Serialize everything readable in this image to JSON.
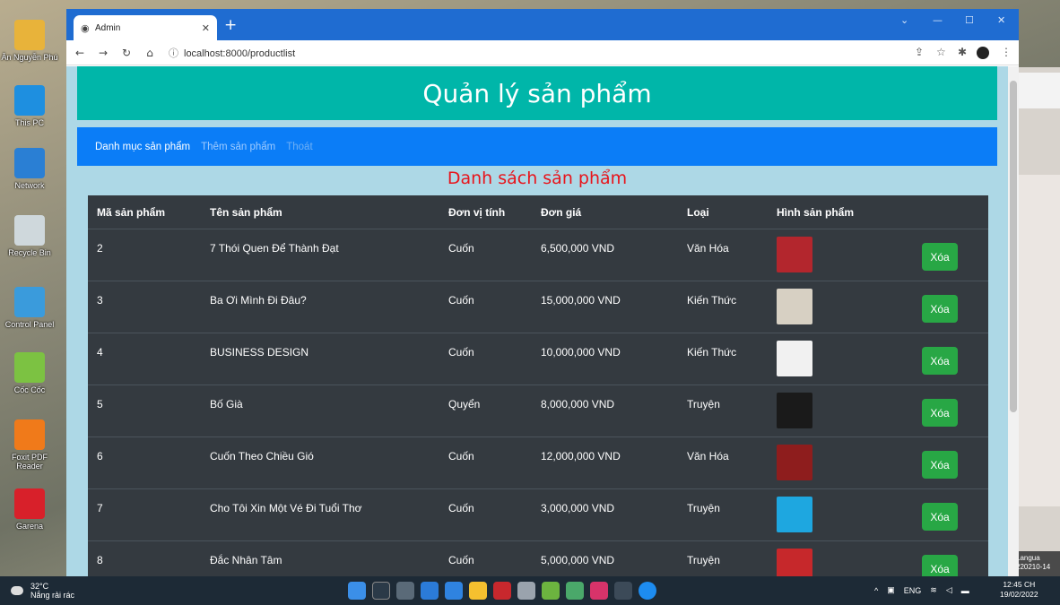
{
  "desktop": {
    "icons": [
      {
        "label": "Ân Nguyễn Phú",
        "color": "#e8b33a"
      },
      {
        "label": "This PC",
        "color": "#1e8fe0"
      },
      {
        "label": "Network",
        "color": "#2a7fd4"
      },
      {
        "label": "Recycle Bin",
        "color": "#cfd8dc"
      },
      {
        "label": "Control Panel",
        "color": "#3a9bdc"
      },
      {
        "label": "Cốc Cốc",
        "color": "#7cc242"
      },
      {
        "label": "Foxit PDF Reader",
        "color": "#f07a1a"
      },
      {
        "label": "Garena",
        "color": "#d8202a"
      }
    ],
    "side_text": "Langua",
    "side_text2": "220210-14"
  },
  "browser": {
    "tab_title": "Admin",
    "url": "localhost:8000/productlist"
  },
  "page": {
    "header_title": "Quản lý sản phẩm",
    "nav": {
      "item1": "Danh mục sản phẩm",
      "item2": "Thêm sản phẩm",
      "item3": "Thoát"
    },
    "list_title": "Danh sách sản phẩm",
    "columns": {
      "id": "Mã sản phẩm",
      "name": "Tên sản phẩm",
      "unit": "Đơn vị tính",
      "price": "Đơn giá",
      "type": "Loại",
      "image": "Hình sản phẩm"
    },
    "delete_label": "Xóa",
    "rows": [
      {
        "id": "2",
        "name": "7 Thói Quen Để Thành Đạt",
        "unit": "Cuốn",
        "price": "6,500,000 VND",
        "type": "Văn Hóa",
        "thumb_color": "#b3262d"
      },
      {
        "id": "3",
        "name": "Ba Ơi Mình Đi Đâu?",
        "unit": "Cuốn",
        "price": "15,000,000 VND",
        "type": "Kiến Thức",
        "thumb_color": "#d7d0c3"
      },
      {
        "id": "4",
        "name": "BUSINESS DESIGN",
        "unit": "Cuốn",
        "price": "10,000,000 VND",
        "type": "Kiến Thức",
        "thumb_color": "#f1f1f1"
      },
      {
        "id": "5",
        "name": "Bố Già",
        "unit": "Quyển",
        "price": "8,000,000 VND",
        "type": "Truyện",
        "thumb_color": "#1a1a1a"
      },
      {
        "id": "6",
        "name": "Cuốn Theo Chiều Gió",
        "unit": "Cuốn",
        "price": "12,000,000 VND",
        "type": "Văn Hóa",
        "thumb_color": "#8e1d1d"
      },
      {
        "id": "7",
        "name": "Cho Tôi Xin Một Vé Đi Tuổi Thơ",
        "unit": "Cuốn",
        "price": "3,000,000 VND",
        "type": "Truyện",
        "thumb_color": "#1ea7e0"
      },
      {
        "id": "8",
        "name": "Đắc Nhân Tâm",
        "unit": "Cuốn",
        "price": "5,000,000 VND",
        "type": "Truyện",
        "thumb_color": "#c6282b"
      }
    ]
  },
  "taskbar": {
    "temp": "32°C",
    "weather_text": "Nắng rải rác",
    "lang": "ENG",
    "time": "12:45 CH",
    "date": "19/02/2022"
  }
}
